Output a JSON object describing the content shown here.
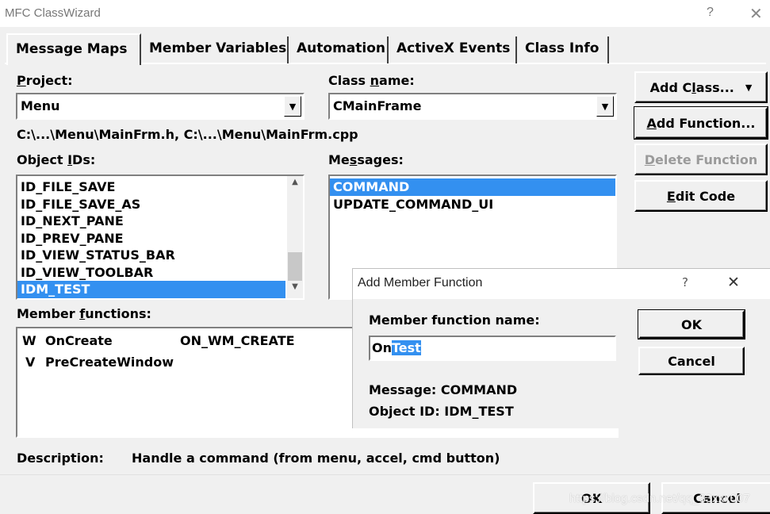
{
  "window": {
    "title": "MFC ClassWizard",
    "help": "?",
    "close": "✕"
  },
  "tabs": [
    {
      "label": "Message Maps",
      "active": true
    },
    {
      "label": "Member Variables"
    },
    {
      "label": "Automation"
    },
    {
      "label": "ActiveX Events"
    },
    {
      "label": "Class Info"
    }
  ],
  "project": {
    "label_u": "P",
    "label_rest": "roject:",
    "value": "Menu"
  },
  "class_name": {
    "label_a": "Class ",
    "label_u": "n",
    "label_rest": "ame:",
    "value": "CMainFrame"
  },
  "files": "C:\\...\\Menu\\MainFrm.h, C:\\...\\Menu\\MainFrm.cpp",
  "object_ids": {
    "label_a": "Object ",
    "label_u": "I",
    "label_rest": "Ds:",
    "items": [
      "ID_FILE_SAVE",
      "ID_FILE_SAVE_AS",
      "ID_NEXT_PANE",
      "ID_PREV_PANE",
      "ID_VIEW_STATUS_BAR",
      "ID_VIEW_TOOLBAR",
      "IDM_TEST"
    ],
    "selected": "IDM_TEST"
  },
  "messages": {
    "label_a": "Me",
    "label_u": "s",
    "label_rest": "sages:",
    "items": [
      "COMMAND",
      "UPDATE_COMMAND_UI"
    ],
    "selected": "COMMAND"
  },
  "buttons": {
    "add_class": {
      "a": "Add C",
      "u": "l",
      "rest": "ass...",
      "arrow": "▼"
    },
    "add_function": {
      "a": "",
      "u": "A",
      "rest": "dd Function..."
    },
    "delete_function": {
      "a": "",
      "u": "D",
      "rest": "elete Function"
    },
    "edit_code": {
      "a": "",
      "u": "E",
      "rest": "dit Code"
    }
  },
  "member_functions": {
    "label_a": "Member ",
    "label_u": "f",
    "label_rest": "unctions:",
    "rows": [
      {
        "type": "W",
        "name": "OnCreate",
        "map": "ON_WM_CREATE"
      },
      {
        "type": "V",
        "name": "PreCreateWindow",
        "map": ""
      }
    ]
  },
  "description": {
    "label": "Description:",
    "text": "Handle a command (from menu, accel, cmd button)"
  },
  "add_member_dialog": {
    "title": "Add Member Function",
    "help": "?",
    "close": "✕",
    "name_label": "Member function name:",
    "name_prefix": "On",
    "name_selected": "Test",
    "message_line": "Message: COMMAND",
    "object_id_line": "Object ID: IDM_TEST",
    "ok": "OK",
    "cancel": "Cancel"
  },
  "footer": {
    "ok": "OK",
    "cancel": "Cancel"
  },
  "watermark": "https://blog.csdn.net/qq_33xxx007"
}
